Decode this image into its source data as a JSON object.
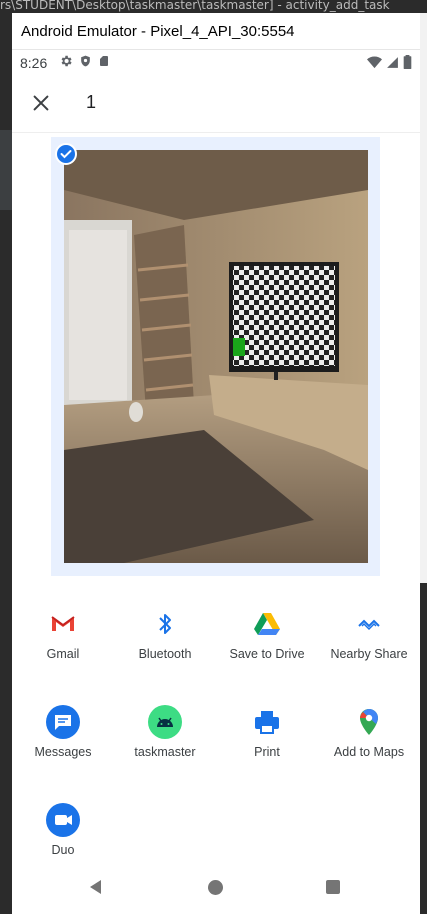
{
  "ide": {
    "path_text": "rs\\STUDENT\\Desktop\\taskmaster\\taskmaster] - activity_add_task"
  },
  "window": {
    "title": "Android Emulator - Pixel_4_API_30:5554"
  },
  "status_bar": {
    "time": "8:26"
  },
  "header": {
    "selected_count": "1"
  },
  "share_targets": [
    {
      "label": "Gmail",
      "icon": "gmail-icon"
    },
    {
      "label": "Bluetooth",
      "icon": "bluetooth-icon"
    },
    {
      "label": "Save to Drive",
      "icon": "drive-icon"
    },
    {
      "label": "Nearby Share",
      "icon": "nearby-share-icon"
    },
    {
      "label": "Messages",
      "icon": "messages-icon"
    },
    {
      "label": "taskmaster",
      "icon": "android-icon"
    },
    {
      "label": "Print",
      "icon": "print-icon"
    },
    {
      "label": "Add to Maps",
      "icon": "maps-pin-icon"
    },
    {
      "label": "Duo",
      "icon": "duo-icon"
    }
  ],
  "colors": {
    "accent": "#1a73e8",
    "selection_bg": "#e8f0fe"
  }
}
